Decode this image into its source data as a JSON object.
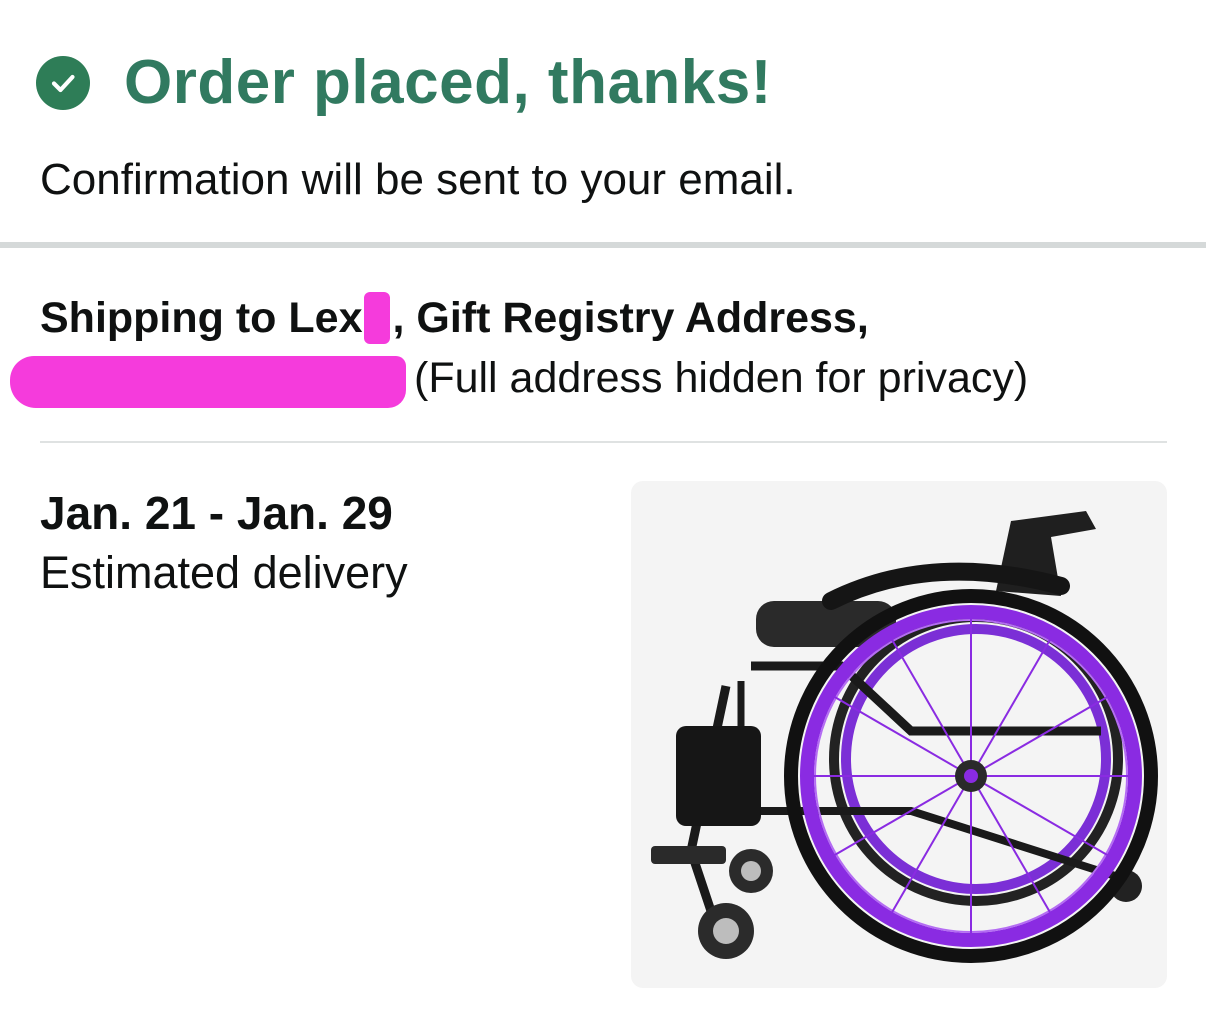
{
  "header": {
    "title": "Order placed, thanks!",
    "subtitle": "Confirmation will be sent to your email.",
    "icon": "check-circle-icon",
    "accent_color": "#317a60"
  },
  "shipping": {
    "prefix": "Shipping to Lex",
    "suffix": ", Gift Registry Address,",
    "privacy_note": "(Full address hidden for privacy)",
    "redaction_color": "#f53bdc"
  },
  "delivery": {
    "dates": "Jan. 21 - Jan. 29",
    "label": "Estimated delivery"
  },
  "product": {
    "image": "purple-wheelchair-image",
    "rim_color": "#8a2be2"
  }
}
